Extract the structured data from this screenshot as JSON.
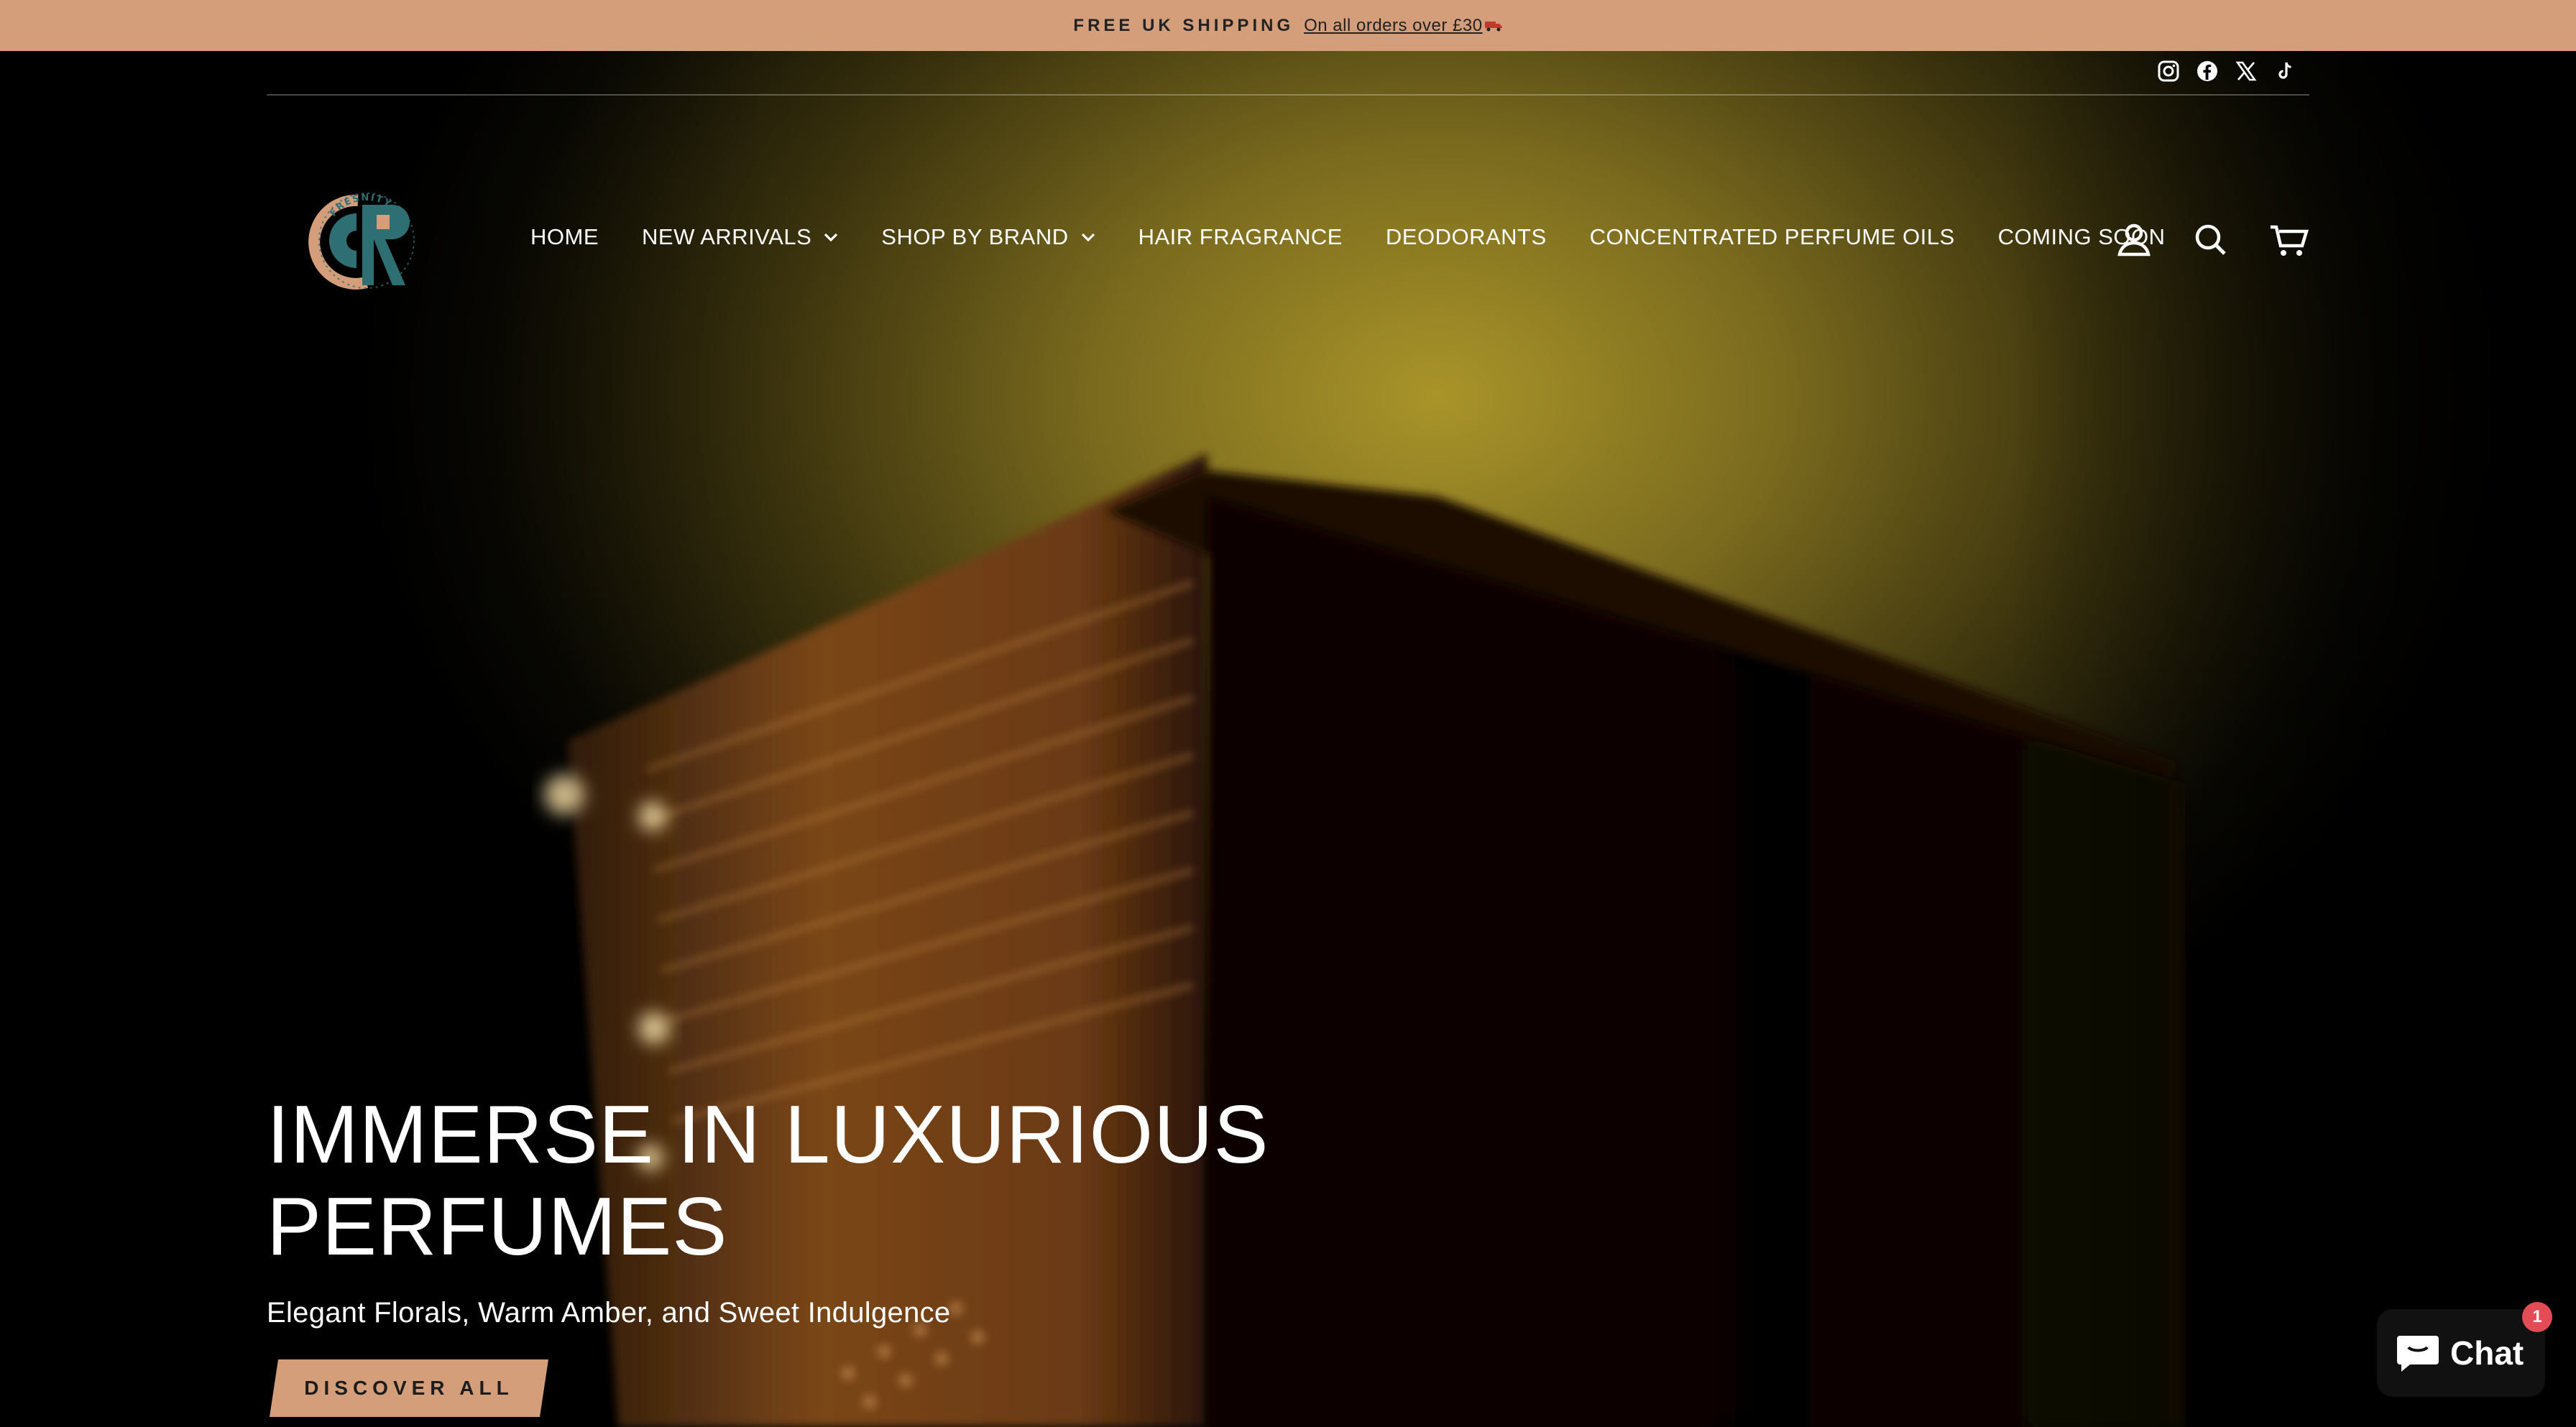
{
  "announcement": {
    "prefix": "FREE UK SHIPPING",
    "link": "On all orders over £30"
  },
  "social": [
    "instagram-icon",
    "facebook-icon",
    "x-icon",
    "tiktok-icon"
  ],
  "brand": {
    "logo_text": "FRESNITY",
    "monogram": "FR",
    "colors": {
      "teal": "#2e6f73",
      "copper": "#d49e7b"
    }
  },
  "nav": {
    "items": [
      {
        "label": "HOME"
      },
      {
        "label": "NEW ARRIVALS",
        "dropdown": true
      },
      {
        "label": "SHOP BY BRAND",
        "dropdown": true
      },
      {
        "label": "HAIR FRAGRANCE"
      },
      {
        "label": "DEODORANTS"
      },
      {
        "label": "CONCENTRATED PERFUME OILS"
      },
      {
        "label": "COMING SOON"
      }
    ]
  },
  "header_icons": [
    "account-icon",
    "search-icon",
    "cart-icon"
  ],
  "hero": {
    "headline": "IMMERSE IN LUXURIOUS PERFUMES",
    "subheading": "Elegant Florals, Warm Amber, and Sweet Indulgence",
    "cta": "DISCOVER ALL"
  },
  "chat": {
    "label": "Chat",
    "badge": "1"
  },
  "colors": {
    "accent": "#d49e7b",
    "chat_badge": "#e34b55"
  }
}
